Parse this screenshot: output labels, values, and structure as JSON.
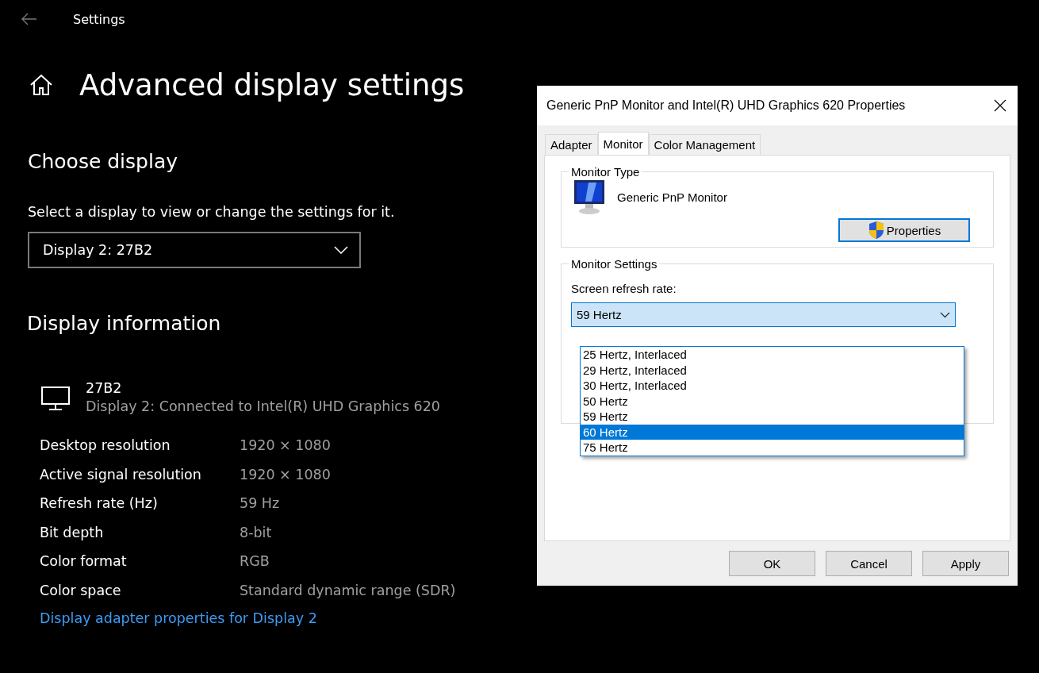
{
  "settings_window": {
    "title": "Settings",
    "heading": "Advanced display settings",
    "choose_display": {
      "heading": "Choose display",
      "prompt": "Select a display to view or change the settings for it.",
      "dropdown": {
        "value": "Display 2: 27B2"
      }
    },
    "display_information": {
      "heading": "Display information",
      "display": {
        "name": "27B2",
        "description": "Display 2: Connected to Intel(R) UHD Graphics 620"
      },
      "rows": [
        {
          "label": "Desktop resolution",
          "value": "1920 × 1080"
        },
        {
          "label": "Active signal resolution",
          "value": "1920 × 1080"
        },
        {
          "label": "Refresh rate (Hz)",
          "value": "59 Hz"
        },
        {
          "label": "Bit depth",
          "value": "8-bit"
        },
        {
          "label": "Color format",
          "value": "RGB"
        },
        {
          "label": "Color space",
          "value": "Standard dynamic range (SDR)"
        }
      ],
      "link": "Display adapter properties for Display 2"
    }
  },
  "dialog": {
    "title": "Generic PnP Monitor and Intel(R) UHD Graphics 620 Properties",
    "tabs": [
      {
        "label": "Adapter",
        "selected": false
      },
      {
        "label": "Monitor",
        "selected": true
      },
      {
        "label": "Color Management",
        "selected": false
      }
    ],
    "monitor_type": {
      "legend": "Monitor Type",
      "name": "Generic PnP Monitor",
      "button": "Properties"
    },
    "monitor_settings": {
      "legend": "Monitor Settings",
      "label": "Screen refresh rate:",
      "dropdown": {
        "value": "59 Hertz",
        "expanded": true,
        "options": [
          {
            "label": "25 Hertz, Interlaced",
            "highlighted": false
          },
          {
            "label": "29 Hertz, Interlaced",
            "highlighted": false
          },
          {
            "label": "30 Hertz, Interlaced",
            "highlighted": false
          },
          {
            "label": "50 Hertz",
            "highlighted": false
          },
          {
            "label": "59 Hertz",
            "highlighted": false
          },
          {
            "label": "60 Hertz",
            "highlighted": true
          },
          {
            "label": "75 Hertz",
            "highlighted": false
          }
        ]
      }
    },
    "buttons": [
      "OK",
      "Cancel",
      "Apply"
    ]
  }
}
